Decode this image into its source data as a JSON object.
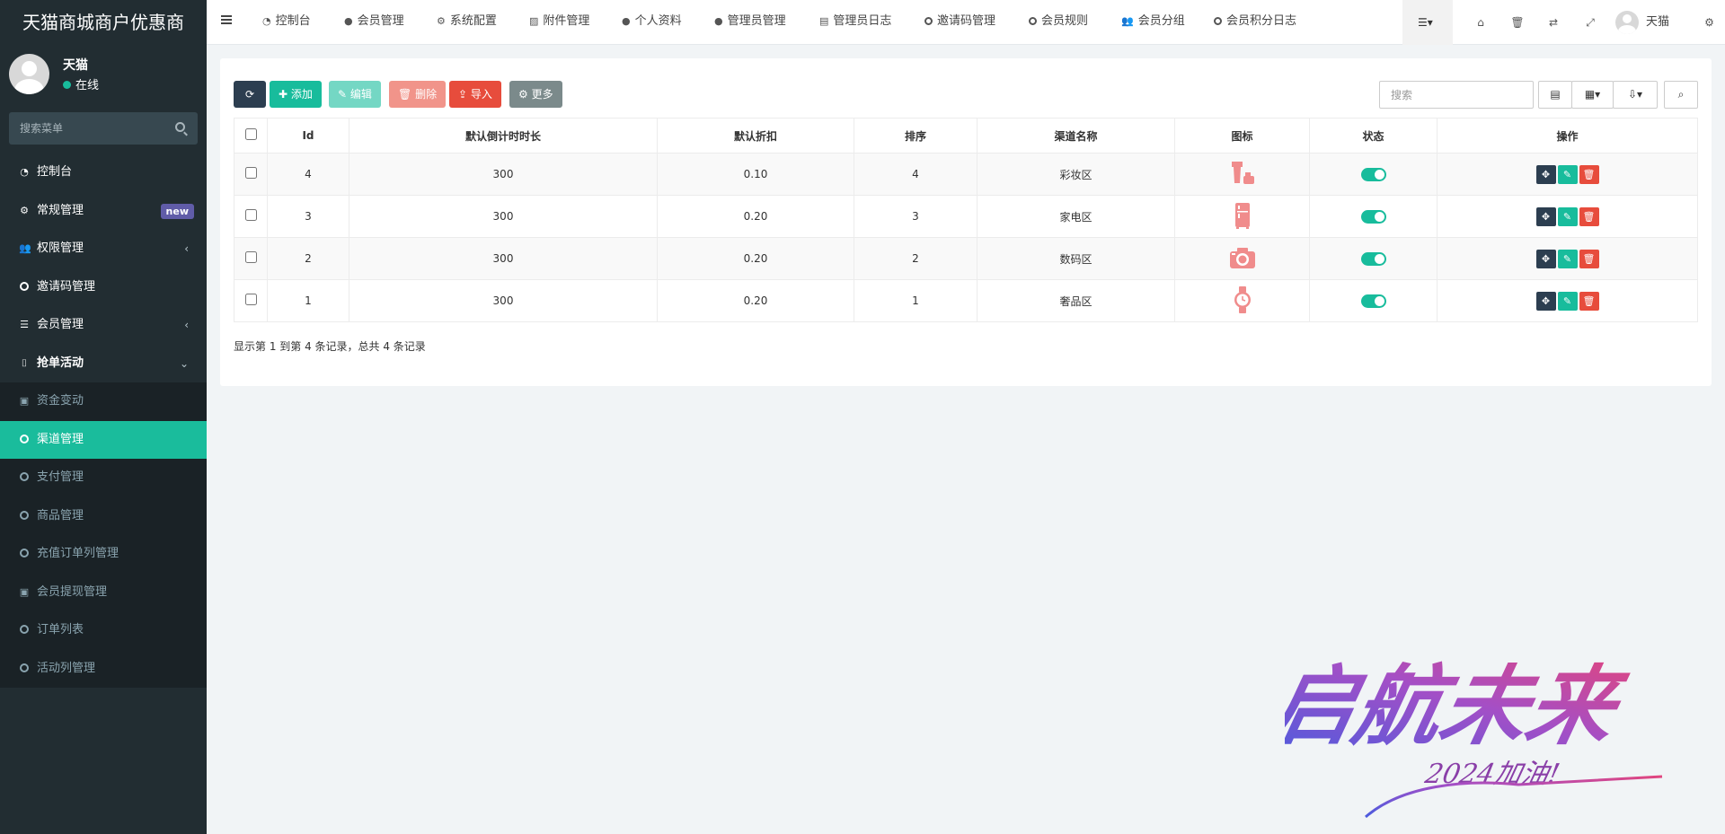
{
  "brand": {
    "title": "天猫商城商户优惠商"
  },
  "user": {
    "name": "天猫",
    "status": "在线"
  },
  "side_search": {
    "placeholder": "搜索菜单"
  },
  "sidebar": {
    "items": [
      {
        "label": "控制台",
        "icon": "dashboard-icon"
      },
      {
        "label": "常规管理",
        "icon": "cogs-icon",
        "badge": "new"
      },
      {
        "label": "权限管理",
        "icon": "group-icon"
      },
      {
        "label": "邀请码管理",
        "icon": "circle-icon"
      },
      {
        "label": "会员管理",
        "icon": "list-icon"
      },
      {
        "label": "抢单活动",
        "icon": "bookmark-icon"
      },
      {
        "label": "资金变动",
        "icon": "money-icon"
      },
      {
        "label": "渠道管理",
        "icon": "circle-icon"
      },
      {
        "label": "支付管理",
        "icon": "circle-icon"
      },
      {
        "label": "商品管理",
        "icon": "circle-icon"
      },
      {
        "label": "充值订单列管理",
        "icon": "circle-icon"
      },
      {
        "label": "会员提现管理",
        "icon": "money-icon"
      },
      {
        "label": "订单列表",
        "icon": "circle-icon"
      },
      {
        "label": "活动列管理",
        "icon": "circle-icon"
      }
    ]
  },
  "topnav": {
    "items": [
      {
        "label": "控制台",
        "icon": "dashboard-icon"
      },
      {
        "label": "会员管理",
        "icon": "user-icon"
      },
      {
        "label": "系统配置",
        "icon": "gear-icon"
      },
      {
        "label": "附件管理",
        "icon": "image-icon"
      },
      {
        "label": "个人资料",
        "icon": "user-icon"
      },
      {
        "label": "管理员管理",
        "icon": "user-icon"
      },
      {
        "label": "管理员日志",
        "icon": "list-alt-icon"
      },
      {
        "label": "邀请码管理",
        "icon": "circle-icon"
      },
      {
        "label": "会员规则",
        "icon": "circle-icon"
      },
      {
        "label": "会员分组",
        "icon": "group-icon"
      },
      {
        "label": "会员积分日志",
        "icon": "circle-icon"
      }
    ],
    "user_name": "天猫"
  },
  "toolbar": {
    "refresh_icon": "refresh-icon",
    "add_label": "添加",
    "edit_label": "编辑",
    "delete_label": "删除",
    "import_label": "导入",
    "more_label": "更多",
    "search_placeholder": "搜索"
  },
  "table": {
    "columns": [
      "Id",
      "默认倒计时时长",
      "默认折扣",
      "排序",
      "渠道名称",
      "图标",
      "状态",
      "操作"
    ],
    "rows": [
      {
        "id": "4",
        "duration": "300",
        "discount": "0.10",
        "sort": "4",
        "name": "彩妆区",
        "icon": "cosmetics-icon",
        "status": "on"
      },
      {
        "id": "3",
        "duration": "300",
        "discount": "0.20",
        "sort": "3",
        "name": "家电区",
        "icon": "fridge-icon",
        "status": "on"
      },
      {
        "id": "2",
        "duration": "300",
        "discount": "0.20",
        "sort": "2",
        "name": "数码区",
        "icon": "camera-icon",
        "status": "on"
      },
      {
        "id": "1",
        "duration": "300",
        "discount": "0.20",
        "sort": "1",
        "name": "奢品区",
        "icon": "watch-icon",
        "status": "on"
      }
    ]
  },
  "pagination": {
    "summary": "显示第 1 到第 4 条记录，总共 4 条记录"
  },
  "watermark": {
    "text": "启航未来",
    "subtext": "2024加油!"
  },
  "colors": {
    "sidebar_bg": "#222d32",
    "accent": "#18bc9c",
    "dark_btn": "#2c3e50",
    "danger": "#e74c3c",
    "icon_pink": "#f08c8c"
  }
}
